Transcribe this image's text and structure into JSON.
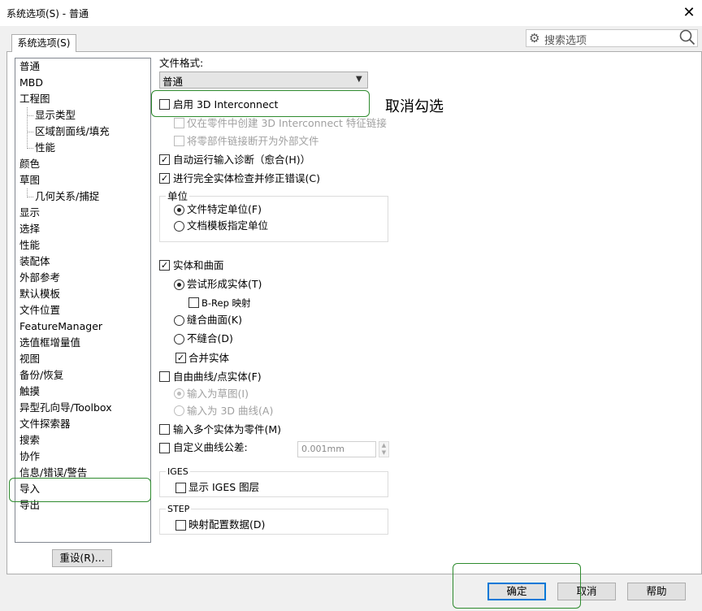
{
  "window": {
    "title": "系统选项(S) - 普通",
    "close_glyph": "✕"
  },
  "tab": {
    "label": "系统选项(S)"
  },
  "search": {
    "placeholder": "搜索选项"
  },
  "tree": {
    "items": [
      {
        "label": "普通",
        "level": 0
      },
      {
        "label": "MBD",
        "level": 0
      },
      {
        "label": "工程图",
        "level": 0
      },
      {
        "label": "显示类型",
        "level": 1
      },
      {
        "label": "区域剖面线/填充",
        "level": 1
      },
      {
        "label": "性能",
        "level": 1
      },
      {
        "label": "颜色",
        "level": 0
      },
      {
        "label": "草图",
        "level": 0
      },
      {
        "label": "几何关系/捕捉",
        "level": 1
      },
      {
        "label": "显示",
        "level": 0
      },
      {
        "label": "选择",
        "level": 0
      },
      {
        "label": "性能",
        "level": 0
      },
      {
        "label": "装配体",
        "level": 0
      },
      {
        "label": "外部参考",
        "level": 0
      },
      {
        "label": "默认模板",
        "level": 0
      },
      {
        "label": "文件位置",
        "level": 0
      },
      {
        "label": "FeatureManager",
        "level": 0
      },
      {
        "label": "选值框增量值",
        "level": 0
      },
      {
        "label": "视图",
        "level": 0
      },
      {
        "label": "备份/恢复",
        "level": 0
      },
      {
        "label": "触摸",
        "level": 0
      },
      {
        "label": "异型孔向导/Toolbox",
        "level": 0
      },
      {
        "label": "文件探索器",
        "level": 0
      },
      {
        "label": "搜索",
        "level": 0
      },
      {
        "label": "协作",
        "level": 0
      },
      {
        "label": "信息/错误/警告",
        "level": 0
      },
      {
        "label": "导入",
        "level": 0
      },
      {
        "label": "导出",
        "level": 0
      }
    ],
    "reset_label": "重设(R)..."
  },
  "options": {
    "file_format_label": "文件格式:",
    "file_format_value": "普通",
    "enable_3d_interconnect": "启用 3D Interconnect",
    "only_in_part": "仅在零件中创建 3D Interconnect 特征链接",
    "break_link": "将零部件链接断开为外部文件",
    "auto_diagnose": "自动运行输入诊断（愈合(H)）",
    "full_check": "进行完全实体检查并修正错误(C)",
    "units_group": "单位",
    "units_file": "文件特定单位(F)",
    "units_template": "文档模板指定单位",
    "solid_surface": "实体和曲面",
    "try_solid": "尝试形成实体(T)",
    "brep": "B-Rep 映射",
    "knit_surface": "缝合曲面(K)",
    "no_knit": "不缝合(D)",
    "merge_solid": "合并实体",
    "free_curve": "自由曲线/点实体(F)",
    "as_sketch": "输入为草图(I)",
    "as_3d_curve": "输入为 3D 曲线(A)",
    "multi_body": "输入多个实体为零件(M)",
    "custom_tol": "自定义曲线公差:",
    "tol_value": "0.001mm",
    "iges_group": "IGES",
    "iges_layers": "显示 IGES 图层",
    "step_group": "STEP",
    "step_map": "映射配置数据(D)"
  },
  "state": {
    "enable_3d_interconnect": false,
    "only_in_part": false,
    "break_link": false,
    "auto_diagnose": true,
    "full_check": true,
    "units": "file",
    "solid_surface": true,
    "surface_mode": "try_solid",
    "brep": false,
    "merge_solid": true,
    "free_curve": false,
    "free_curve_mode": "as_sketch",
    "multi_body": false,
    "custom_tol": false,
    "iges_layers": false,
    "step_map": false
  },
  "annotation": {
    "text": "取消勾选"
  },
  "buttons": {
    "ok": "确定",
    "cancel": "取消",
    "help": "帮助"
  },
  "colors": {
    "annotation": "#2e8b2e",
    "default_button_border": "#0078d7"
  }
}
